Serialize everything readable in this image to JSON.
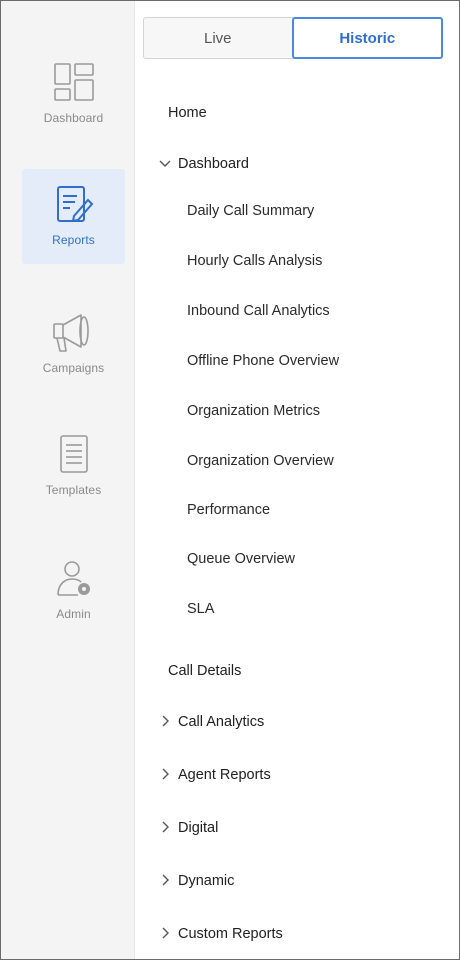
{
  "rail": {
    "items": [
      {
        "label": "Dashboard",
        "icon": "dashboard-icon"
      },
      {
        "label": "Reports",
        "icon": "reports-icon",
        "active": true
      },
      {
        "label": "Campaigns",
        "icon": "megaphone-icon"
      },
      {
        "label": "Templates",
        "icon": "templates-icon"
      },
      {
        "label": "Admin",
        "icon": "admin-icon"
      }
    ]
  },
  "tabs": [
    {
      "label": "Live"
    },
    {
      "label": "Historic",
      "active": true
    }
  ],
  "nav": {
    "home": "Home",
    "dashboard": {
      "label": "Dashboard",
      "expanded": true,
      "children": [
        "Daily Call Summary",
        "Hourly Calls Analysis",
        "Inbound Call Analytics",
        "Offline Phone Overview",
        "Organization Metrics",
        "Organization Overview",
        "Performance",
        "Queue Overview",
        "SLA"
      ]
    },
    "call_details": "Call Details",
    "groups": [
      "Call Analytics",
      "Agent Reports",
      "Digital",
      "Dynamic",
      "Custom Reports"
    ]
  },
  "colors": {
    "accent": "#2f6fcb",
    "active_bg": "#e3ecf8",
    "rail_bg": "#f4f4f4"
  }
}
